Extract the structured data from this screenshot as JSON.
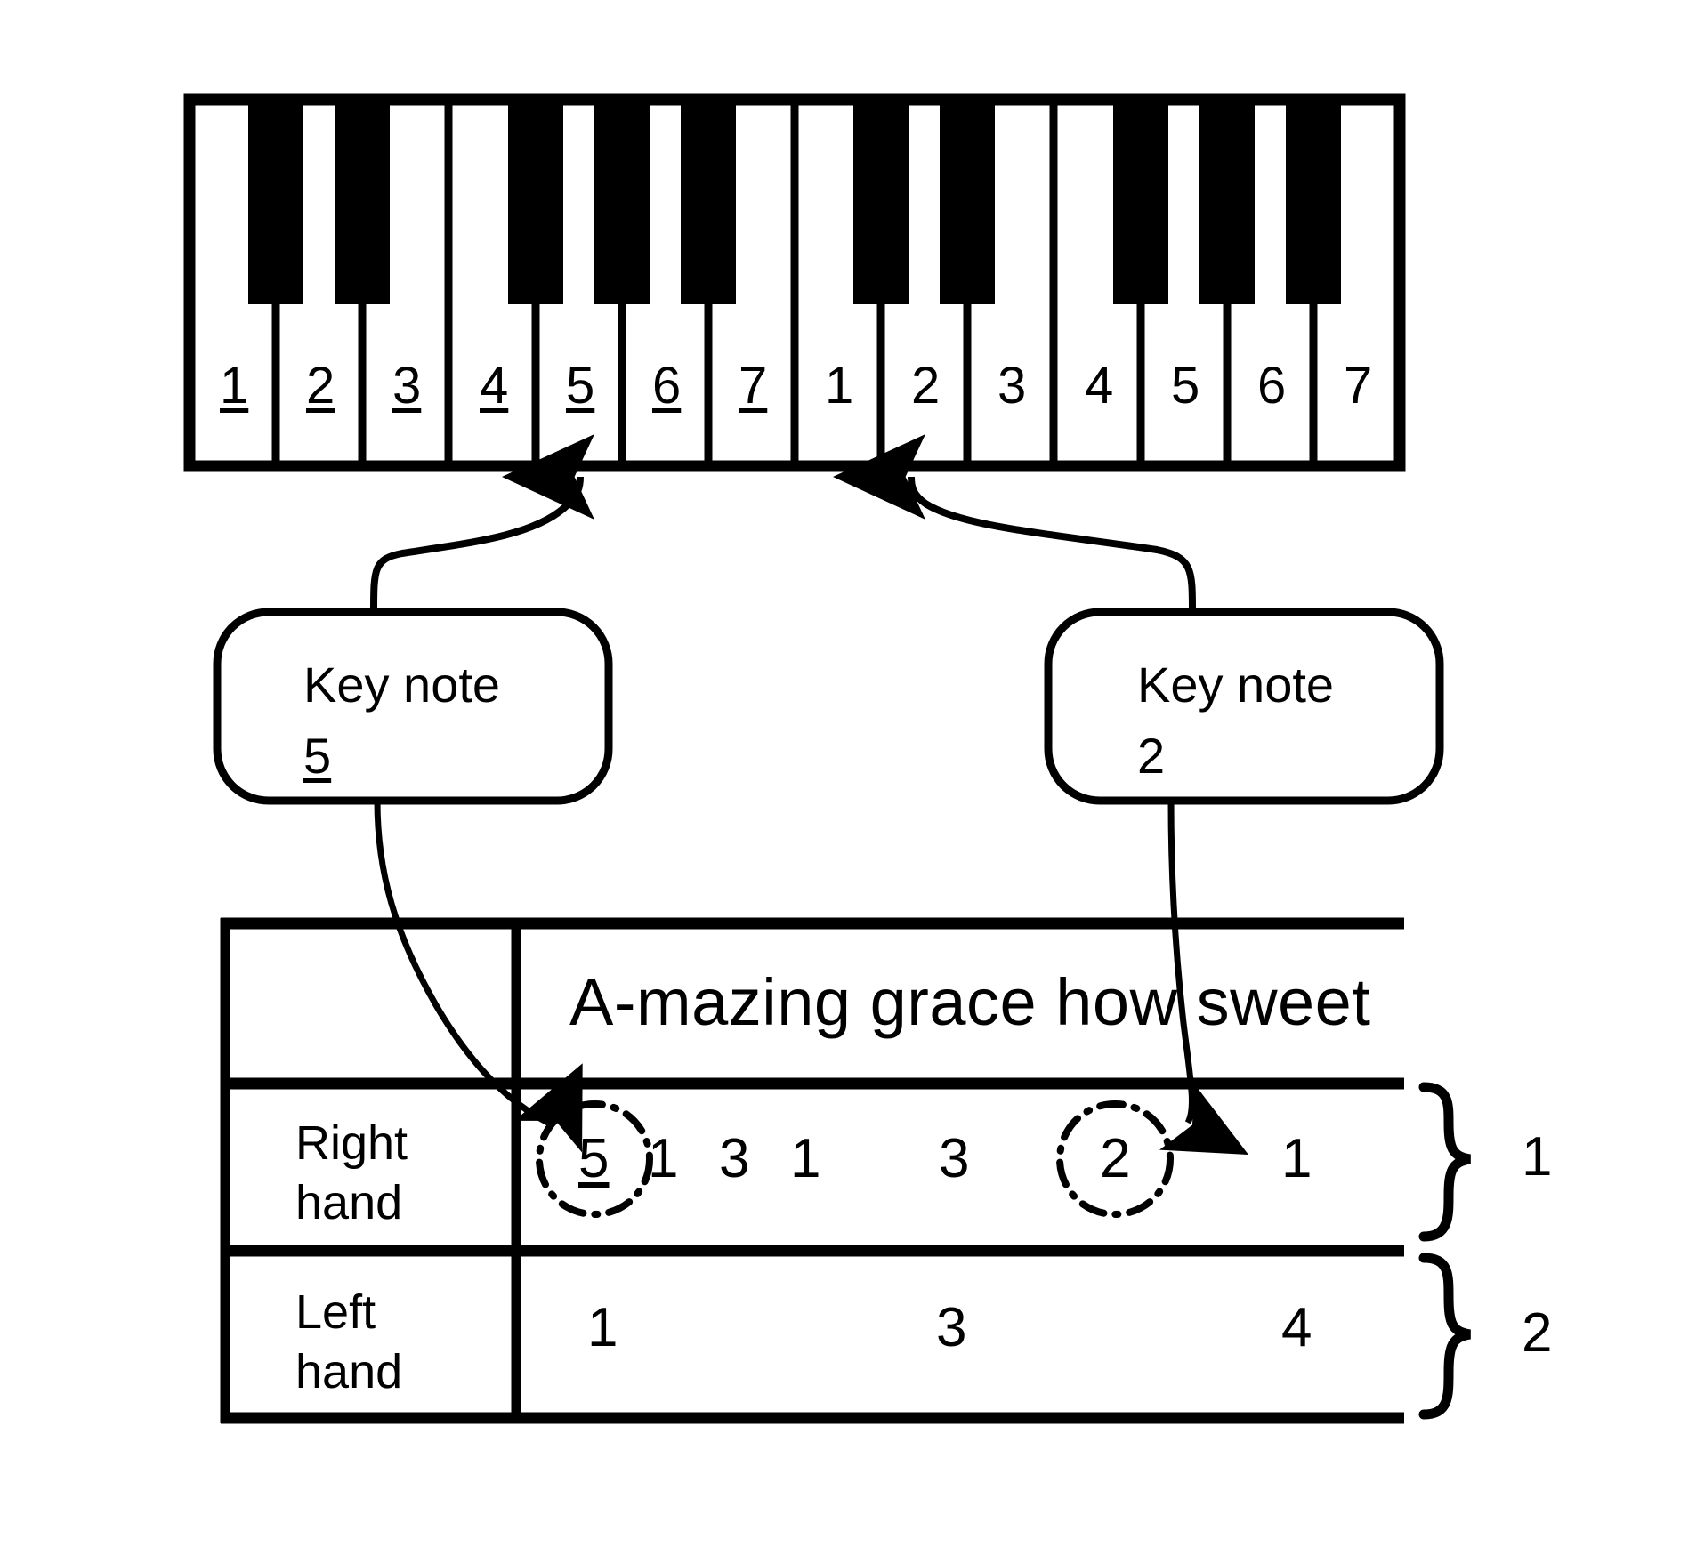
{
  "diagram": {
    "keyboard": {
      "octave_low_labels": [
        "1",
        "2",
        "3",
        "4",
        "5",
        "6",
        "7"
      ],
      "octave_high_labels": [
        "1",
        "2",
        "3",
        "4",
        "5",
        "6",
        "7"
      ],
      "low_octave_underlined": true,
      "high_octave_underlined": false,
      "white_key_count": 14,
      "black_key_count": 10
    },
    "callouts": [
      {
        "id": "key-note-left",
        "title": "Key note",
        "value": "5",
        "value_underlined": true,
        "points_to_key": "5"
      },
      {
        "id": "key-note-right",
        "title": "Key note",
        "value": "2",
        "value_underlined": false,
        "points_to_key": "2"
      }
    ],
    "table": {
      "lyric_row": {
        "label": "",
        "lyrics": "A-mazing grace how sweet"
      },
      "rows": [
        {
          "label": "Right\nhand",
          "label_line1": "Right",
          "label_line2": "hand",
          "notes": [
            {
              "text": "5",
              "underlined": true,
              "circled": true
            },
            {
              "text": "1",
              "underlined": false,
              "circled": false
            },
            {
              "text": "3",
              "underlined": false,
              "circled": false
            },
            {
              "text": "1",
              "underlined": false,
              "circled": false
            },
            {
              "text": "3",
              "underlined": false,
              "circled": false
            },
            {
              "text": "2",
              "underlined": false,
              "circled": true
            },
            {
              "text": "1",
              "underlined": false,
              "circled": false
            }
          ]
        },
        {
          "label": "Left\nhand",
          "label_line1": "Left",
          "label_line2": "hand",
          "notes": [
            {
              "text": "1",
              "underlined": false,
              "circled": false
            },
            {
              "text": "3",
              "underlined": false,
              "circled": false
            },
            {
              "text": "4",
              "underlined": false,
              "circled": false
            }
          ]
        }
      ]
    },
    "brace_labels": [
      {
        "text": "1",
        "for_row": "Right hand"
      },
      {
        "text": "2",
        "for_row": "Left hand"
      }
    ],
    "colors": {
      "ink": "#000000",
      "paper": "#ffffff",
      "black_key": "#000000",
      "white_key": "#ffffff"
    }
  }
}
